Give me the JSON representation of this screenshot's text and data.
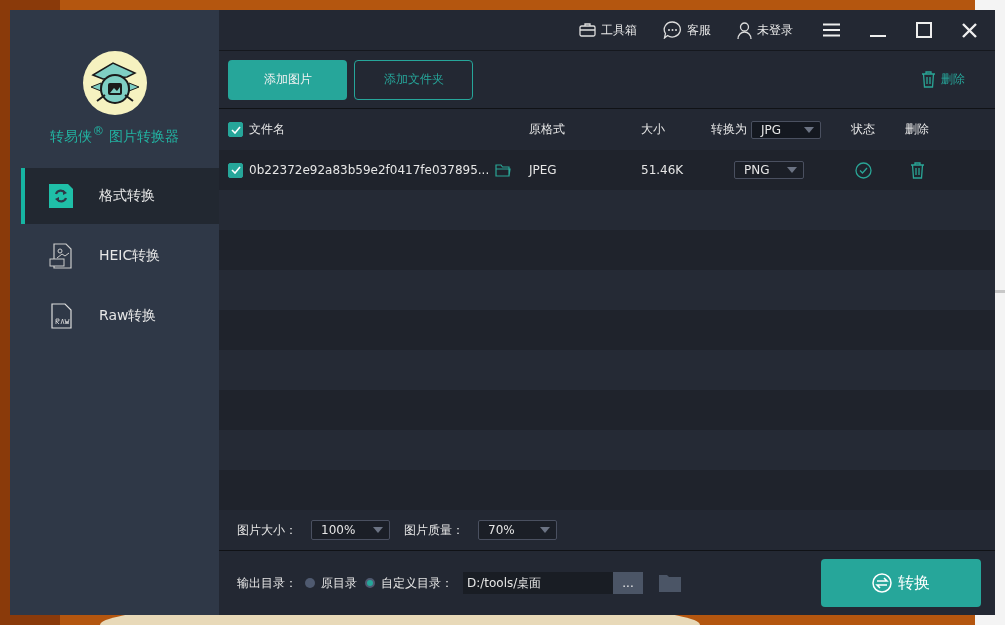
{
  "title_bar": {
    "items": [
      {
        "kind": "toolbox",
        "label": "工具箱"
      },
      {
        "kind": "chat",
        "label": "客服"
      },
      {
        "kind": "user",
        "label": "未登录"
      }
    ]
  },
  "app": {
    "name": "转易侠$^{®}$ 图片转换器"
  },
  "sidebar": {
    "items": [
      {
        "kind": "format",
        "label": "格式转换",
        "selected": true
      },
      {
        "kind": "heic",
        "label": "HEIC转换",
        "selected": false
      },
      {
        "kind": "raw",
        "label": "Raw转换",
        "selected": false
      }
    ]
  },
  "toolbar": {
    "add_images": "添加图片",
    "add_folder": "添加文件夹",
    "delete": "删除"
  },
  "table": {
    "select_all": true,
    "columns": {
      "name": "文件名",
      "format": "原格式",
      "size": "大小",
      "convert_to": "转换为",
      "status": "状态",
      "delete": "删除"
    },
    "convert_all": "JPG",
    "rows": [
      {
        "checked": true,
        "name": "0b22372e92a83b59e2f0417fe037895...",
        "format": "JPEG",
        "size": "51.46K",
        "target": "PNG",
        "converted": true
      }
    ]
  },
  "settings": {
    "size_label": "图片大小：",
    "size": "100%",
    "quality_label": "图片质量：",
    "quality": "70%"
  },
  "output": {
    "label": "输出目录：",
    "options": [
      {
        "label": "原目录",
        "selected": false
      },
      {
        "label": "自定义目录：",
        "selected": true
      }
    ],
    "path": "D:/tools/桌面",
    "browse": "...",
    "convert": "转换"
  }
}
